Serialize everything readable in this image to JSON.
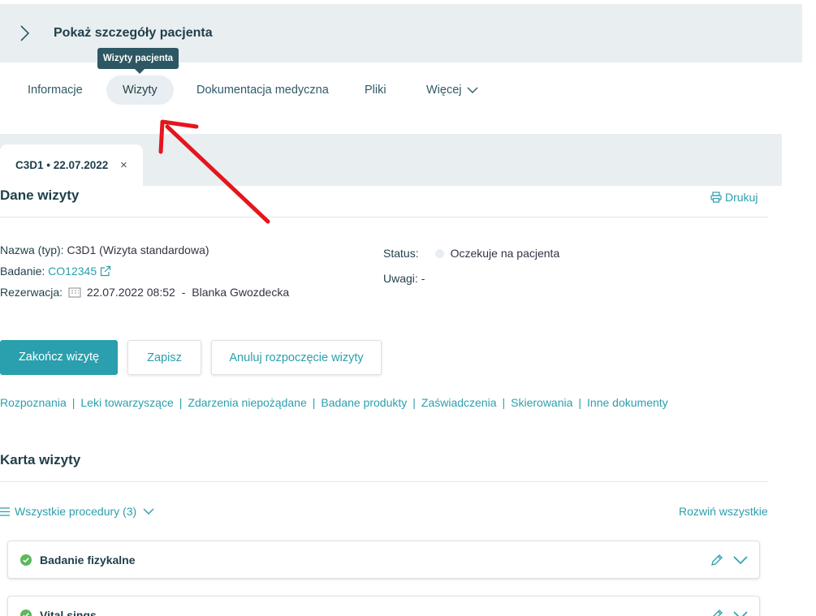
{
  "header": {
    "title": "Pokaż szczegóły pacjenta",
    "tooltip": "Wizyty pacjenta"
  },
  "nav_tabs": [
    {
      "label": "Informacje"
    },
    {
      "label": "Wizyty"
    },
    {
      "label": "Dokumentacja medyczna"
    },
    {
      "label": "Pliki"
    },
    {
      "label": "Więcej"
    }
  ],
  "visit_tab": {
    "label": "C3D1 • 22.07.2022",
    "close": "×"
  },
  "visit_details": {
    "title": "Dane wizyty",
    "print_label": "Drukuj",
    "name_key": "Nazwa (typ):",
    "name_value": "C3D1 (Wizyta standardowa)",
    "study_key": "Badanie:",
    "study_value": "CO12345",
    "reservation_key": "Rezerwacja:",
    "reservation_value": "22.07.2022 08:52",
    "reservation_sep": "-",
    "reservation_person": "Blanka Gwozdecka",
    "status_key": "Status:",
    "status_value": "Oczekuje na pacjenta",
    "notes_key": "Uwagi:",
    "notes_value": "-"
  },
  "actions": {
    "finish": "Zakończ wizytę",
    "save": "Zapisz",
    "cancel_start": "Anuluj rozpoczęcie wizyty"
  },
  "quick_links": [
    "Rozpoznania",
    "Leki towarzyszące",
    "Zdarzenia niepożądane",
    "Badane produkty",
    "Zaświadczenia",
    "Skierowania",
    "Inne dokumenty"
  ],
  "quick_links_sep": "|",
  "card_section": {
    "title": "Karta wizyty",
    "filter_label": "Wszystkie procedury (3)",
    "expand_all": "Rozwiń wszystkie",
    "procedures": [
      {
        "name": "Badanie fizykalne"
      },
      {
        "name": "Vital sings"
      }
    ]
  },
  "colors": {
    "accent": "#2a9fad",
    "text_dark": "#1e3f4a",
    "panel_bg": "#e9eef1",
    "check_green": "#5cb85c",
    "annotation_red": "#e4161d"
  }
}
